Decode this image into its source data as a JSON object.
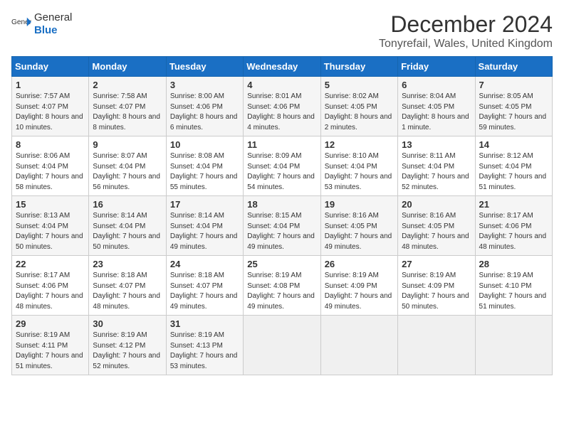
{
  "header": {
    "logo_general": "General",
    "logo_blue": "Blue",
    "title": "December 2024",
    "location": "Tonyrefail, Wales, United Kingdom"
  },
  "calendar": {
    "days_of_week": [
      "Sunday",
      "Monday",
      "Tuesday",
      "Wednesday",
      "Thursday",
      "Friday",
      "Saturday"
    ],
    "weeks": [
      [
        {
          "day": 1,
          "sunrise": "7:57 AM",
          "sunset": "4:07 PM",
          "daylight": "8 hours and 10 minutes."
        },
        {
          "day": 2,
          "sunrise": "7:58 AM",
          "sunset": "4:07 PM",
          "daylight": "8 hours and 8 minutes."
        },
        {
          "day": 3,
          "sunrise": "8:00 AM",
          "sunset": "4:06 PM",
          "daylight": "8 hours and 6 minutes."
        },
        {
          "day": 4,
          "sunrise": "8:01 AM",
          "sunset": "4:06 PM",
          "daylight": "8 hours and 4 minutes."
        },
        {
          "day": 5,
          "sunrise": "8:02 AM",
          "sunset": "4:05 PM",
          "daylight": "8 hours and 2 minutes."
        },
        {
          "day": 6,
          "sunrise": "8:04 AM",
          "sunset": "4:05 PM",
          "daylight": "8 hours and 1 minute."
        },
        {
          "day": 7,
          "sunrise": "8:05 AM",
          "sunset": "4:05 PM",
          "daylight": "7 hours and 59 minutes."
        }
      ],
      [
        {
          "day": 8,
          "sunrise": "8:06 AM",
          "sunset": "4:04 PM",
          "daylight": "7 hours and 58 minutes."
        },
        {
          "day": 9,
          "sunrise": "8:07 AM",
          "sunset": "4:04 PM",
          "daylight": "7 hours and 56 minutes."
        },
        {
          "day": 10,
          "sunrise": "8:08 AM",
          "sunset": "4:04 PM",
          "daylight": "7 hours and 55 minutes."
        },
        {
          "day": 11,
          "sunrise": "8:09 AM",
          "sunset": "4:04 PM",
          "daylight": "7 hours and 54 minutes."
        },
        {
          "day": 12,
          "sunrise": "8:10 AM",
          "sunset": "4:04 PM",
          "daylight": "7 hours and 53 minutes."
        },
        {
          "day": 13,
          "sunrise": "8:11 AM",
          "sunset": "4:04 PM",
          "daylight": "7 hours and 52 minutes."
        },
        {
          "day": 14,
          "sunrise": "8:12 AM",
          "sunset": "4:04 PM",
          "daylight": "7 hours and 51 minutes."
        }
      ],
      [
        {
          "day": 15,
          "sunrise": "8:13 AM",
          "sunset": "4:04 PM",
          "daylight": "7 hours and 50 minutes."
        },
        {
          "day": 16,
          "sunrise": "8:14 AM",
          "sunset": "4:04 PM",
          "daylight": "7 hours and 50 minutes."
        },
        {
          "day": 17,
          "sunrise": "8:14 AM",
          "sunset": "4:04 PM",
          "daylight": "7 hours and 49 minutes."
        },
        {
          "day": 18,
          "sunrise": "8:15 AM",
          "sunset": "4:04 PM",
          "daylight": "7 hours and 49 minutes."
        },
        {
          "day": 19,
          "sunrise": "8:16 AM",
          "sunset": "4:05 PM",
          "daylight": "7 hours and 49 minutes."
        },
        {
          "day": 20,
          "sunrise": "8:16 AM",
          "sunset": "4:05 PM",
          "daylight": "7 hours and 48 minutes."
        },
        {
          "day": 21,
          "sunrise": "8:17 AM",
          "sunset": "4:06 PM",
          "daylight": "7 hours and 48 minutes."
        }
      ],
      [
        {
          "day": 22,
          "sunrise": "8:17 AM",
          "sunset": "4:06 PM",
          "daylight": "7 hours and 48 minutes."
        },
        {
          "day": 23,
          "sunrise": "8:18 AM",
          "sunset": "4:07 PM",
          "daylight": "7 hours and 48 minutes."
        },
        {
          "day": 24,
          "sunrise": "8:18 AM",
          "sunset": "4:07 PM",
          "daylight": "7 hours and 49 minutes."
        },
        {
          "day": 25,
          "sunrise": "8:19 AM",
          "sunset": "4:08 PM",
          "daylight": "7 hours and 49 minutes."
        },
        {
          "day": 26,
          "sunrise": "8:19 AM",
          "sunset": "4:09 PM",
          "daylight": "7 hours and 49 minutes."
        },
        {
          "day": 27,
          "sunrise": "8:19 AM",
          "sunset": "4:09 PM",
          "daylight": "7 hours and 50 minutes."
        },
        {
          "day": 28,
          "sunrise": "8:19 AM",
          "sunset": "4:10 PM",
          "daylight": "7 hours and 51 minutes."
        }
      ],
      [
        {
          "day": 29,
          "sunrise": "8:19 AM",
          "sunset": "4:11 PM",
          "daylight": "7 hours and 51 minutes."
        },
        {
          "day": 30,
          "sunrise": "8:19 AM",
          "sunset": "4:12 PM",
          "daylight": "7 hours and 52 minutes."
        },
        {
          "day": 31,
          "sunrise": "8:19 AM",
          "sunset": "4:13 PM",
          "daylight": "7 hours and 53 minutes."
        },
        null,
        null,
        null,
        null
      ]
    ]
  }
}
